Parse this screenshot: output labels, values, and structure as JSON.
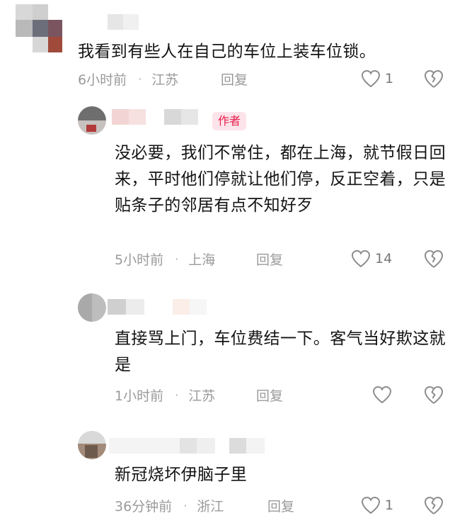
{
  "comments": [
    {
      "text": "我看到有些人在自己的车位上装车位锁。",
      "time": "6小时前",
      "dot": "·",
      "location": "江苏",
      "reply_label": "回复",
      "likes": "1",
      "author_badge": ""
    },
    {
      "text": "没必要，我们不常住，都在上海，就节假日回来，平时他们停就让他们停，反正空着，只是贴条子的邻居有点不知好歹",
      "time": "5小时前",
      "dot": "·",
      "location": "上海",
      "reply_label": "回复",
      "likes": "14",
      "author_badge": "作者"
    },
    {
      "text": "直接骂上门，车位费结一下。客气当好欺这就是",
      "time": "1小时前",
      "dot": "·",
      "location": "江苏",
      "reply_label": "回复",
      "likes": "",
      "author_badge": ""
    },
    {
      "text": "新冠烧坏伊脑子里",
      "time": "36分钟前",
      "dot": "·",
      "location": "浙江",
      "reply_label": "回复",
      "likes": "1",
      "author_badge": ""
    }
  ],
  "icons": {
    "like": "heart-outline-icon",
    "dislike": "broken-heart-outline-icon"
  },
  "colors": {
    "badge_bg": "#fde4ea",
    "badge_text": "#e81e4b",
    "meta": "#9a9a9a",
    "icon": "#8c8c8c"
  }
}
